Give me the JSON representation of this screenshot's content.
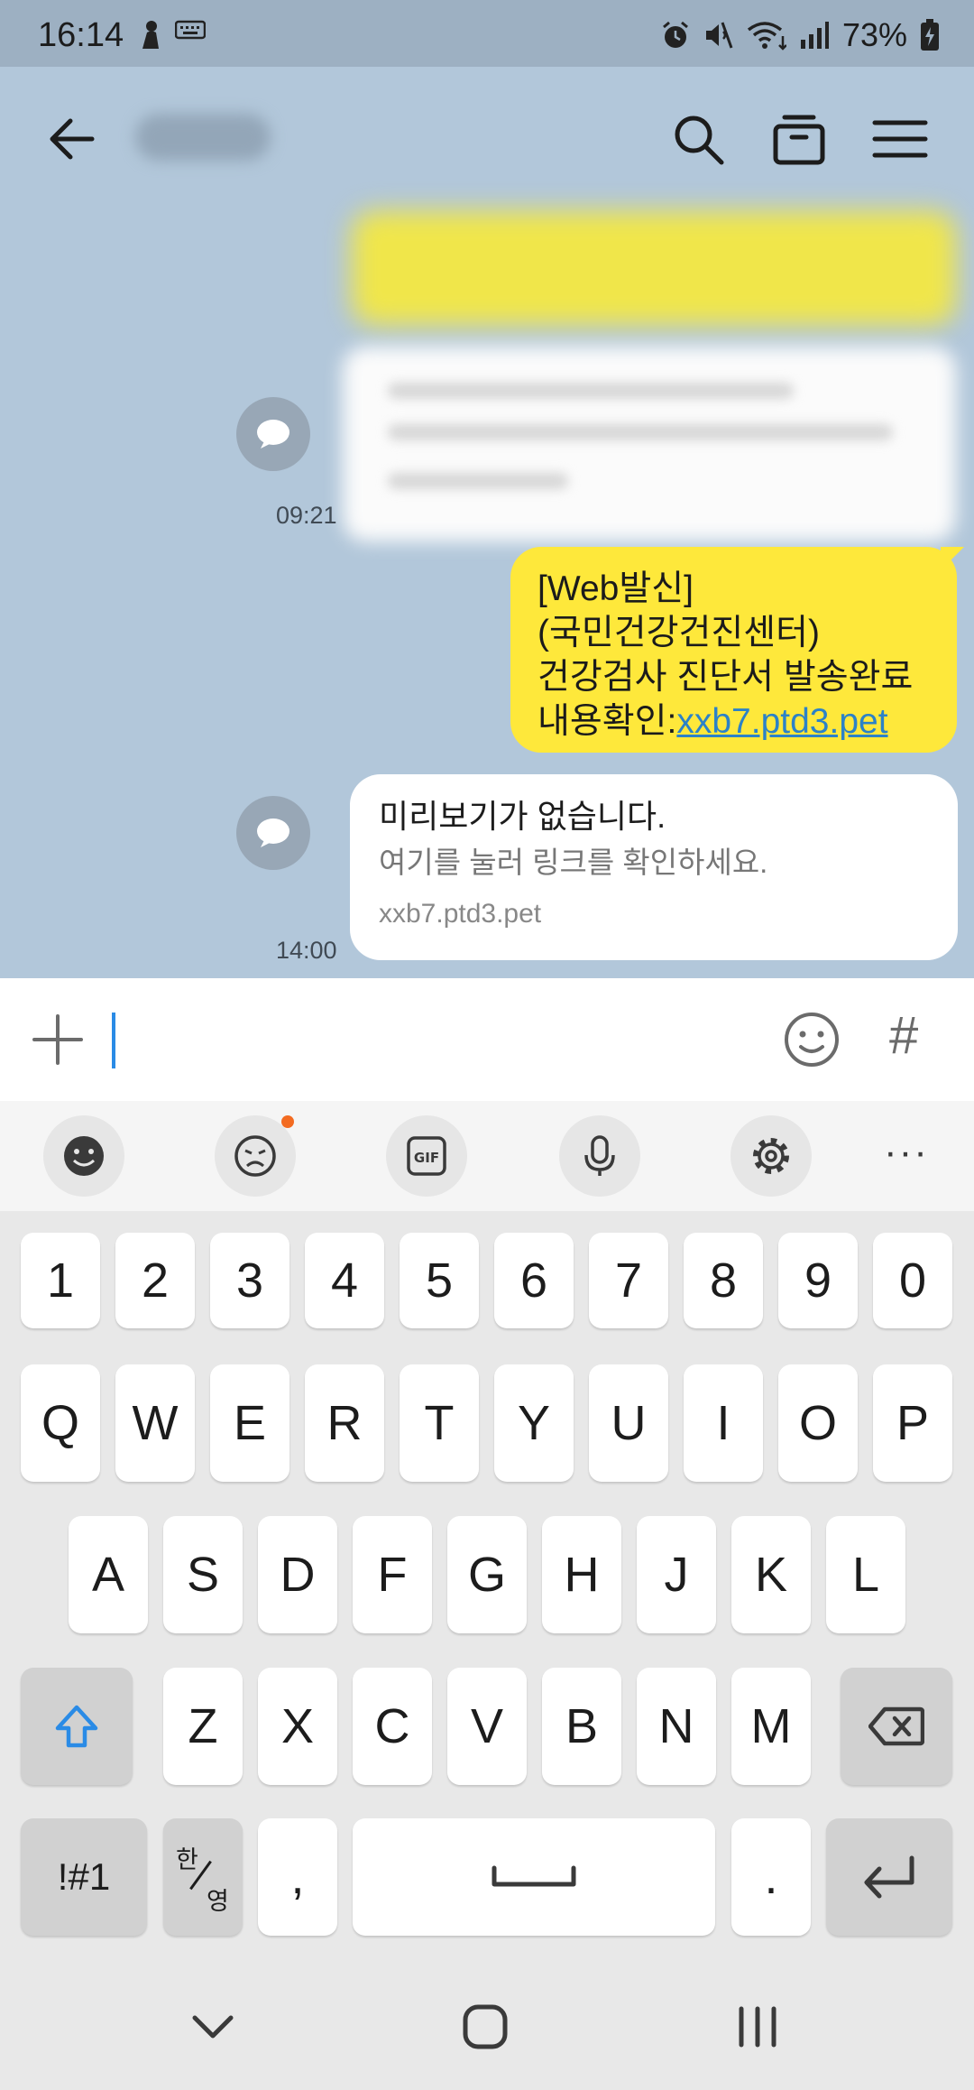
{
  "status_bar": {
    "time": "16:14",
    "battery": "73%",
    "left_icons": [
      "person-icon",
      "keyboard-icon"
    ],
    "right_icons": [
      "alarm-icon",
      "mute-icon",
      "wifi-icon",
      "signal-icon",
      "battery-icon"
    ]
  },
  "header": {
    "chat_name": "",
    "icons": [
      "back-arrow-icon",
      "search-icon",
      "drawer-icon",
      "menu-icon"
    ]
  },
  "messages": {
    "times": [
      "09:21",
      "14:00"
    ],
    "sent_lines": [
      "[Web발신]",
      "(국민건강건진센터)",
      "건강검사 진단서 발송완료"
    ],
    "sent_link_prefix": "내용확인:",
    "sent_link": "xxb7.ptd3.pet",
    "preview_title": "미리보기가 없습니다.",
    "preview_sub": "여기를 눌러 링크를 확인하세요.",
    "preview_domain": "xxb7.ptd3.pet"
  },
  "input": {
    "value": "",
    "hash_label": "#"
  },
  "keyboard_toolbar": {
    "icons": [
      "emoji-icon",
      "sticker-icon",
      "gif-icon",
      "mic-icon",
      "settings-icon"
    ],
    "more_label": "···"
  },
  "keyboard": {
    "numbers": [
      "1",
      "2",
      "3",
      "4",
      "5",
      "6",
      "7",
      "8",
      "9",
      "0"
    ],
    "row1": [
      "Q",
      "W",
      "E",
      "R",
      "T",
      "Y",
      "U",
      "I",
      "O",
      "P"
    ],
    "row2": [
      "A",
      "S",
      "D",
      "F",
      "G",
      "H",
      "J",
      "K",
      "L"
    ],
    "row3": [
      "Z",
      "X",
      "C",
      "V",
      "B",
      "N",
      "M"
    ],
    "symbols_label": "!#1",
    "lang_top": "한",
    "lang_bottom": "영",
    "comma": ",",
    "period": "."
  },
  "nav_bar": {
    "icons": [
      "nav-down-icon",
      "nav-home-icon",
      "nav-recents-icon"
    ]
  },
  "colors": {
    "chat_bg": "#b2c7da",
    "sent_bubble": "#fee83b",
    "link": "#2c82c7",
    "cursor": "#2a8be6",
    "badge": "#f36b21"
  }
}
